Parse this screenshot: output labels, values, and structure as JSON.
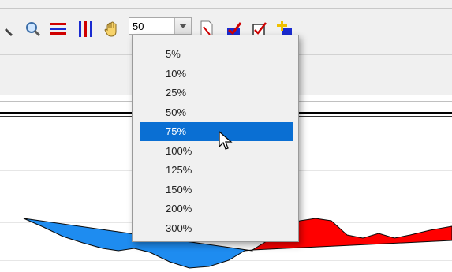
{
  "toolbar": {
    "zoom_value": "50",
    "icons": [
      "magnifier-partial-icon",
      "zoom-in-icon",
      "horizontal-lines-icon",
      "vertical-lines-icon",
      "hand-pan-icon",
      "new-document-icon",
      "edit-check-icon",
      "checkbox-edit-icon",
      "add-node-icon"
    ]
  },
  "zoom_menu": {
    "items": [
      {
        "label": "5%"
      },
      {
        "label": "10%"
      },
      {
        "label": "25%"
      },
      {
        "label": "50%"
      },
      {
        "label": "75%"
      },
      {
        "label": "100%"
      },
      {
        "label": "125%"
      },
      {
        "label": "150%"
      },
      {
        "label": "200%"
      },
      {
        "label": "300%"
      }
    ],
    "highlighted": "75%"
  },
  "colors": {
    "highlight": "#0a6fd3",
    "positive_area": "#ff0000",
    "negative_area": "#1e8cf0"
  }
}
